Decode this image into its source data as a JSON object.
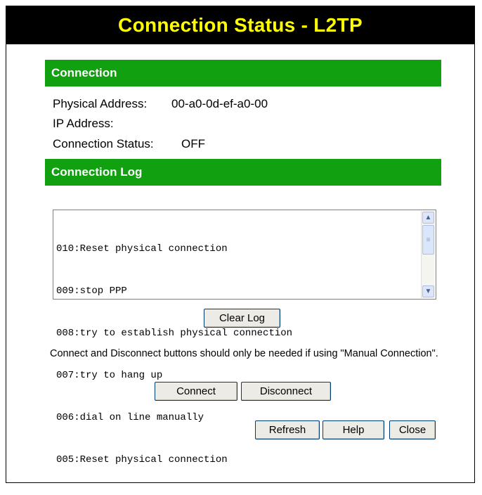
{
  "header": {
    "title": "Connection Status - L2TP"
  },
  "connection": {
    "heading": "Connection",
    "physical_address_label": "Physical Address:",
    "physical_address_value": "00-a0-0d-ef-a0-00",
    "ip_address_label": "IP Address:",
    "ip_address_value": "",
    "status_label": "Connection Status:",
    "status_value": "OFF"
  },
  "log": {
    "heading": "Connection Log",
    "lines": [
      "010:Reset physical connection",
      "009:stop PPP",
      "008:try to establish physical connection",
      "007:try to hang up",
      "006:dial on line manually",
      "005:Reset physical connection"
    ],
    "clear_label": "Clear Log"
  },
  "note": "Connect and Disconnect buttons should only be needed if using \"Manual Connection\".",
  "actions": {
    "connect_label": "Connect",
    "disconnect_label": "Disconnect",
    "refresh_label": "Refresh",
    "help_label": "Help",
    "close_label": "Close"
  },
  "icons": {
    "scroll_up": "chevron-up-icon",
    "scroll_down": "chevron-down-icon"
  },
  "colors": {
    "title_bg": "#000000",
    "title_text": "#ffff00",
    "section_bg": "#10a010"
  }
}
